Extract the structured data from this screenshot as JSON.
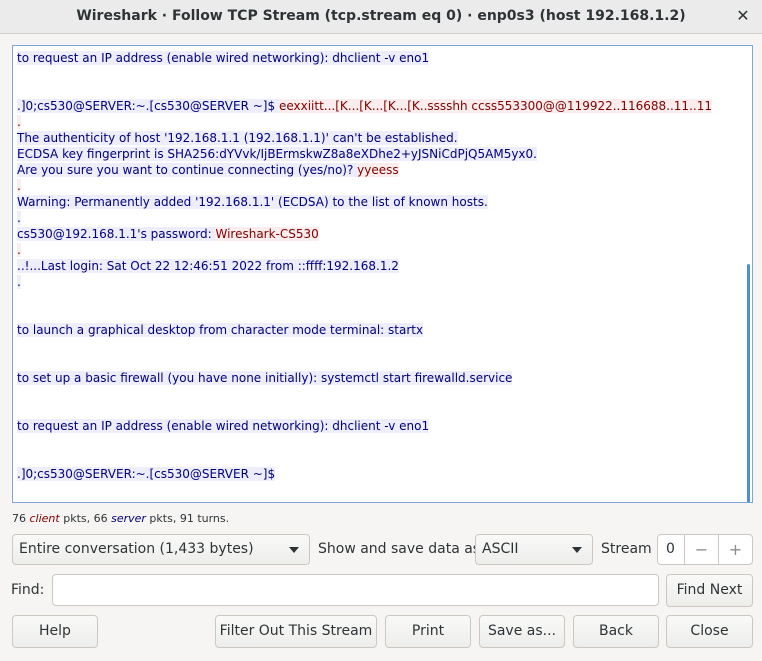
{
  "window": {
    "title": "Wireshark · Follow TCP Stream (tcp.stream eq 0) · enp0s3 (host 192.168.1.2)",
    "close_glyph": "✕"
  },
  "colors": {
    "client_bg": "#fbeded",
    "client_fg": "#7f0000",
    "server_bg": "#ededfb",
    "server_fg": "#00007f"
  },
  "stream_lines": [
    [
      {
        "t": "to request an IP address (enable wired networking):  dhclient -v eno1",
        "who": "s"
      }
    ],
    [
      {
        "t": ".]0;cs530@SERVER:~.[cs530@SERVER ~]$ ",
        "who": "s"
      },
      {
        "t": "eexxiitt...[K...[K...[K...[K..sssshh  ccss553300@@119922..116688..11..11",
        "who": "c"
      }
    ],
    [
      {
        "t": ".",
        "who": "c"
      }
    ],
    [
      {
        "t": "The authenticity of host '192.168.1.1 (192.168.1.1)' can't be established.",
        "who": "s"
      }
    ],
    [
      {
        "t": "ECDSA key fingerprint is SHA256:dYVvk/IjBErmskwZ8a8eXDhe2+yJSNiCdPjQ5AM5yx0.",
        "who": "s"
      }
    ],
    [
      {
        "t": "Are you sure you want to continue connecting (yes/no)? ",
        "who": "s"
      },
      {
        "t": "yyeess",
        "who": "c"
      }
    ],
    [
      {
        "t": ".",
        "who": "c"
      }
    ],
    [
      {
        "t": "Warning: Permanently added '192.168.1.1' (ECDSA) to the list of known hosts.",
        "who": "s"
      }
    ],
    [
      {
        "t": ".",
        "who": "s"
      }
    ],
    [
      {
        "t": "cs530@192.168.1.1's password: ",
        "who": "s"
      },
      {
        "t": "Wireshark-CS530",
        "who": "c"
      }
    ],
    [
      {
        "t": ".",
        "who": "c"
      }
    ],
    [
      {
        "t": "..!...Last login: Sat Oct 22 12:46:51 2022 from ::ffff:192.168.1.2",
        "who": "s"
      }
    ],
    [
      {
        "t": ".",
        "who": "s"
      }
    ],
    [
      {
        "t": "to launch a graphical desktop from character mode terminal:  startx",
        "who": "s"
      }
    ],
    [
      {
        "t": "to set up a basic firewall (you have none initially):  systemctl start firewalld.service",
        "who": "s"
      }
    ],
    [
      {
        "t": "to request an IP address (enable wired networking):  dhclient -v eno1",
        "who": "s"
      }
    ],
    [
      {
        "t": ".]0;cs530@SERVER:~.[cs530@SERVER ~]$ ",
        "who": "s"
      }
    ]
  ],
  "stats": {
    "client_count": "76",
    "client_word": "client",
    "pkts_comma": " pkts, ",
    "server_count": "66",
    "server_word": "server",
    "tail": " pkts, 91 turns."
  },
  "controls": {
    "conversation_select": "Entire conversation (1,433 bytes)",
    "show_label": "Show and save data as",
    "format_select": "ASCII",
    "stream_label": "Stream",
    "stream_value": "0",
    "minus_glyph": "−",
    "plus_glyph": "+",
    "find_label": "Find:",
    "find_value": "",
    "find_next": "Find Next"
  },
  "buttons": {
    "help": "Help",
    "filter_out": "Filter Out This Stream",
    "print": "Print",
    "save_as": "Save as...",
    "back": "Back",
    "close": "Close"
  }
}
